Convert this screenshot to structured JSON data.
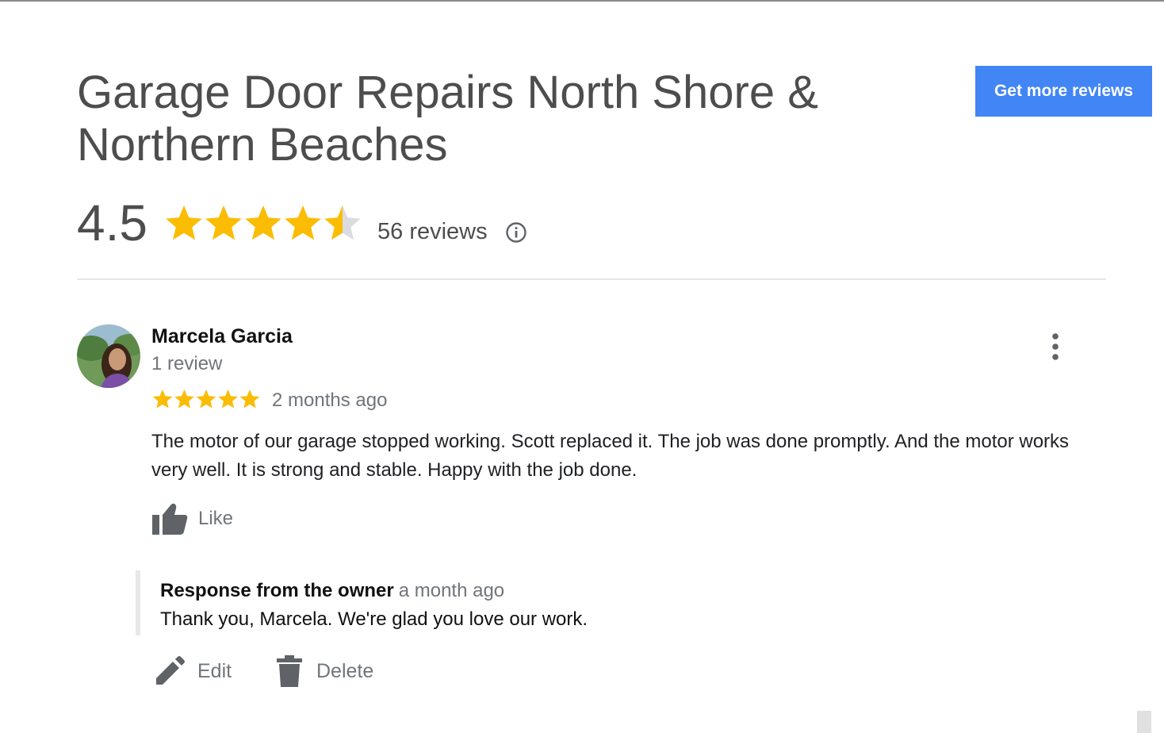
{
  "place": {
    "title": "Garage Door Repairs North Shore & Northern Beaches",
    "cta_label": "Get more reviews",
    "rating_value": "4.5",
    "rating": 4.5,
    "review_count_label": "56 reviews",
    "info_icon": "info-icon"
  },
  "review": {
    "author": "Marcela Garcia",
    "author_meta": "1 review",
    "stars": 5,
    "date": "2 months ago",
    "text": "The motor of our garage stopped working. Scott replaced it. The job was done promptly. And the motor works very well. It is strong and stable. Happy with the job done.",
    "like_label": "Like",
    "more_icon": "more-vert-icon"
  },
  "owner_response": {
    "title": "Response from the owner",
    "date": "a month ago",
    "text": "Thank you, Marcela. We're glad you love our work."
  },
  "actions": {
    "edit_label": "Edit",
    "delete_label": "Delete"
  },
  "colors": {
    "accent": "#4285f4",
    "star": "#fbbc04",
    "star_empty": "#dadce0",
    "muted_text": "#70757a",
    "icon_gray": "#5f6368"
  }
}
